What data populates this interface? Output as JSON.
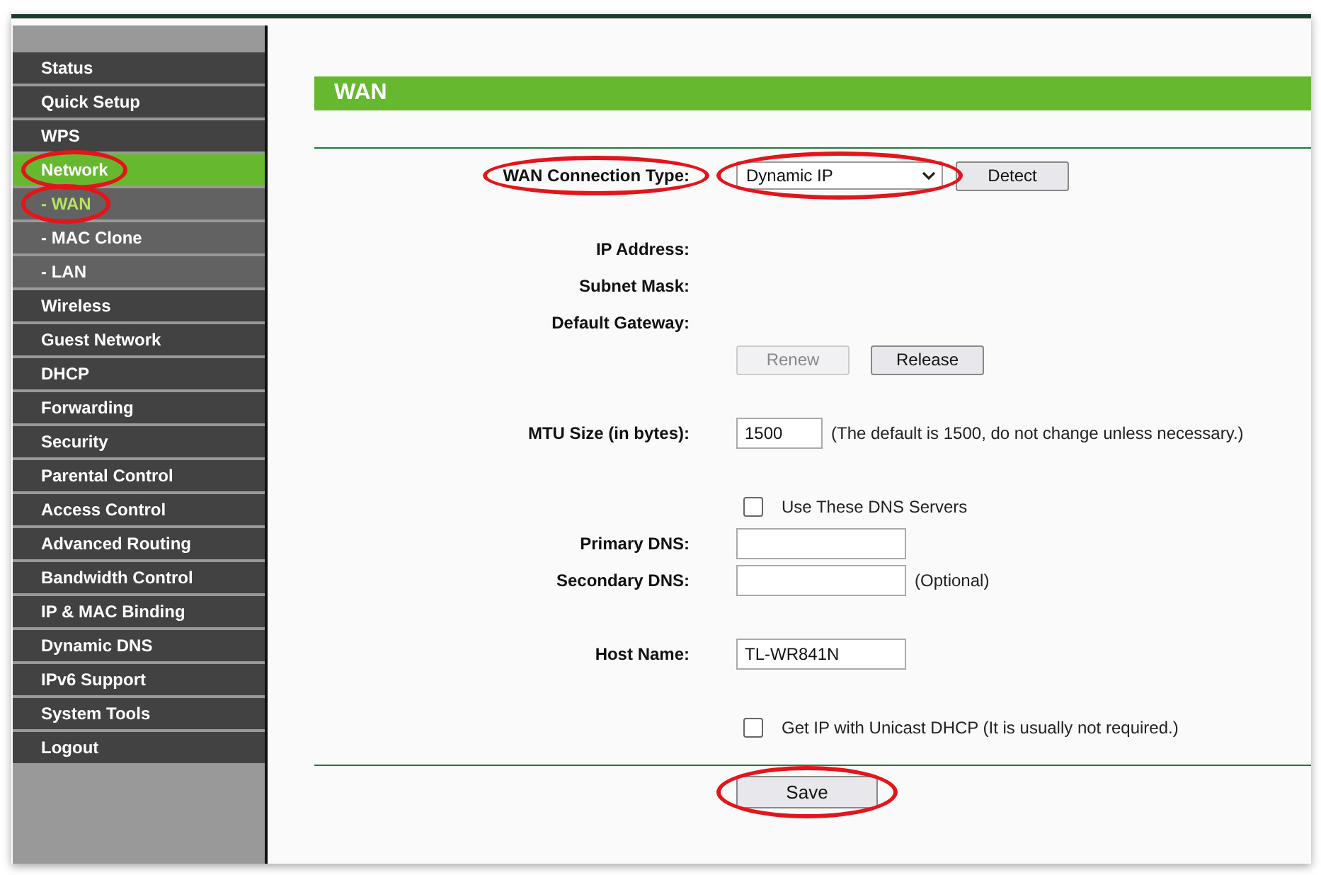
{
  "sidebar": {
    "items": [
      {
        "label": "Status",
        "kind": "main",
        "selected": false,
        "circled": false
      },
      {
        "label": "Quick Setup",
        "kind": "main",
        "selected": false,
        "circled": false
      },
      {
        "label": "WPS",
        "kind": "main",
        "selected": false,
        "circled": false
      },
      {
        "label": "Network",
        "kind": "main",
        "selected": true,
        "circled": true
      },
      {
        "label": "- WAN",
        "kind": "sub",
        "selected": true,
        "circled": true
      },
      {
        "label": "- MAC Clone",
        "kind": "sub",
        "selected": false,
        "circled": false
      },
      {
        "label": "- LAN",
        "kind": "sub",
        "selected": false,
        "circled": false
      },
      {
        "label": "Wireless",
        "kind": "main",
        "selected": false,
        "circled": false
      },
      {
        "label": "Guest Network",
        "kind": "main",
        "selected": false,
        "circled": false
      },
      {
        "label": "DHCP",
        "kind": "main",
        "selected": false,
        "circled": false
      },
      {
        "label": "Forwarding",
        "kind": "main",
        "selected": false,
        "circled": false
      },
      {
        "label": "Security",
        "kind": "main",
        "selected": false,
        "circled": false
      },
      {
        "label": "Parental Control",
        "kind": "main",
        "selected": false,
        "circled": false
      },
      {
        "label": "Access Control",
        "kind": "main",
        "selected": false,
        "circled": false
      },
      {
        "label": "Advanced Routing",
        "kind": "main",
        "selected": false,
        "circled": false
      },
      {
        "label": "Bandwidth Control",
        "kind": "main",
        "selected": false,
        "circled": false
      },
      {
        "label": "IP & MAC Binding",
        "kind": "main",
        "selected": false,
        "circled": false
      },
      {
        "label": "Dynamic DNS",
        "kind": "main",
        "selected": false,
        "circled": false
      },
      {
        "label": "IPv6 Support",
        "kind": "main",
        "selected": false,
        "circled": false
      },
      {
        "label": "System Tools",
        "kind": "main",
        "selected": false,
        "circled": false
      },
      {
        "label": "Logout",
        "kind": "main",
        "selected": false,
        "circled": false
      }
    ]
  },
  "header": {
    "title": "WAN"
  },
  "sections": [
    [
      {
        "kind": "select",
        "label": "WAN Connection Type:",
        "value": "Dynamic IP",
        "label_circled": true,
        "value_circled": true,
        "button": "Detect"
      }
    ],
    [
      {
        "kind": "info",
        "label": "IP Address:"
      },
      {
        "kind": "info",
        "label": "Subnet Mask:"
      },
      {
        "kind": "info",
        "label": "Default Gateway:"
      },
      {
        "kind": "buttons",
        "buttons": [
          {
            "label": "Renew",
            "disabled": true
          },
          {
            "label": "Release",
            "disabled": false
          }
        ]
      }
    ],
    [
      {
        "kind": "number",
        "label": "MTU Size (in bytes):",
        "value": "1500",
        "note": "(The default is 1500, do not change unless necessary.)"
      }
    ],
    [
      {
        "kind": "checkbox",
        "label": "Use These DNS Servers",
        "checked": false
      },
      {
        "kind": "text",
        "label": "Primary DNS:"
      },
      {
        "kind": "text",
        "label": "Secondary DNS:",
        "note": "(Optional)"
      }
    ],
    [
      {
        "kind": "text",
        "label": "Host Name:",
        "value": "TL-WR841N"
      }
    ],
    [
      {
        "kind": "checkbox",
        "label": "Get IP with Unicast DHCP (It is usually not required.)",
        "checked": false
      }
    ]
  ],
  "save_button": {
    "label": "Save",
    "circled": true
  }
}
